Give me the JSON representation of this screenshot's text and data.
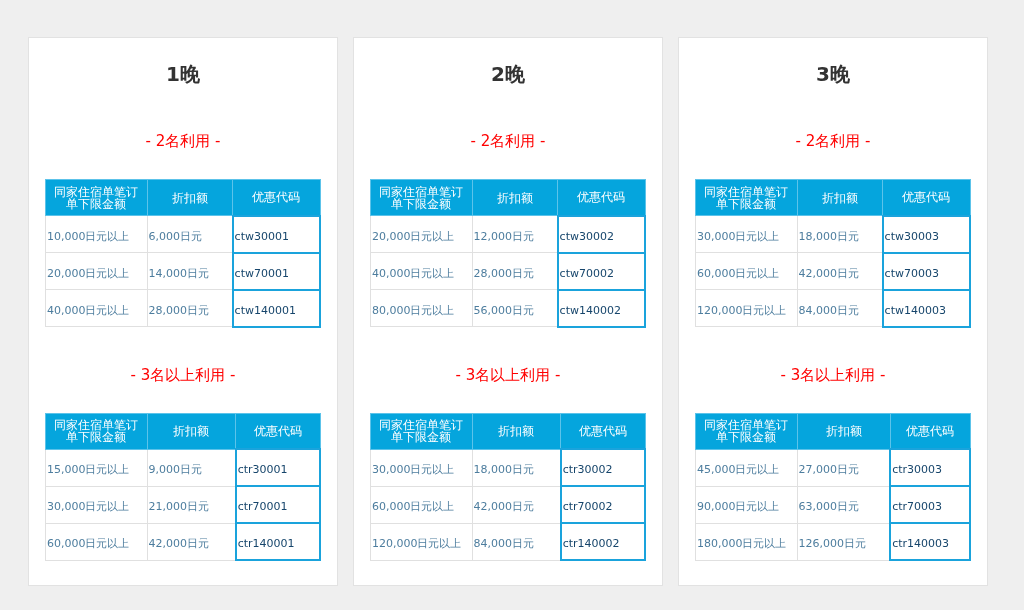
{
  "cards": [
    {
      "title": "1晚",
      "sections": [
        {
          "heading": "- 2名利用 -",
          "columns": [
            "同家住宿单笔订单下限金额",
            "折扣额",
            "优惠代码"
          ],
          "rows": [
            [
              "10,000日元以上",
              "6,000日元",
              "ctw30001"
            ],
            [
              "20,000日元以上",
              "14,000日元",
              "ctw70001"
            ],
            [
              "40,000日元以上",
              "28,000日元",
              "ctw140001"
            ]
          ]
        },
        {
          "heading": "- 3名以上利用 -",
          "columns": [
            "同家住宿单笔订单下限金额",
            "折扣额",
            "优惠代码"
          ],
          "rows": [
            [
              "15,000日元以上",
              "9,000日元",
              "ctr30001"
            ],
            [
              "30,000日元以上",
              "21,000日元",
              "ctr70001"
            ],
            [
              "60,000日元以上",
              "42,000日元",
              "ctr140001"
            ]
          ]
        }
      ]
    },
    {
      "title": "2晚",
      "sections": [
        {
          "heading": "- 2名利用 -",
          "columns": [
            "同家住宿单笔订单下限金额",
            "折扣额",
            "优惠代码"
          ],
          "rows": [
            [
              "20,000日元以上",
              "12,000日元",
              "ctw30002"
            ],
            [
              "40,000日元以上",
              "28,000日元",
              "ctw70002"
            ],
            [
              "80,000日元以上",
              "56,000日元",
              "ctw140002"
            ]
          ]
        },
        {
          "heading": "- 3名以上利用 -",
          "columns": [
            "同家住宿单笔订单下限金额",
            "折扣额",
            "优惠代码"
          ],
          "rows": [
            [
              "30,000日元以上",
              "18,000日元",
              "ctr30002"
            ],
            [
              "60,000日元以上",
              "42,000日元",
              "ctr70002"
            ],
            [
              "120,000日元以上",
              "84,000日元",
              "ctr140002"
            ]
          ]
        }
      ]
    },
    {
      "title": "3晚",
      "sections": [
        {
          "heading": "- 2名利用 -",
          "columns": [
            "同家住宿单笔订单下限金额",
            "折扣额",
            "优惠代码"
          ],
          "rows": [
            [
              "30,000日元以上",
              "18,000日元",
              "ctw30003"
            ],
            [
              "60,000日元以上",
              "42,000日元",
              "ctw70003"
            ],
            [
              "120,000日元以上",
              "84,000日元",
              "ctw140003"
            ]
          ]
        },
        {
          "heading": "- 3名以上利用 -",
          "columns": [
            "同家住宿单笔订单下限金额",
            "折扣额",
            "优惠代码"
          ],
          "rows": [
            [
              "45,000日元以上",
              "27,000日元",
              "ctr30003"
            ],
            [
              "90,000日元以上",
              "63,000日元",
              "ctr70003"
            ],
            [
              "180,000日元以上",
              "126,000日元",
              "ctr140003"
            ]
          ]
        }
      ]
    }
  ]
}
